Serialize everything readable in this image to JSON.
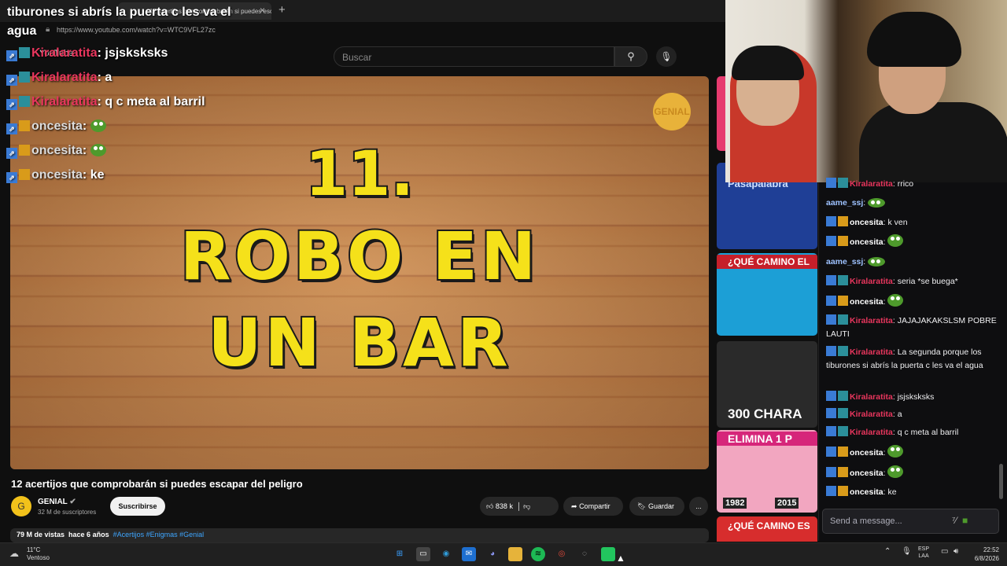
{
  "window_title": "tiburones si abrís la puerta c les va el agua",
  "browser": {
    "tab_title": "12 acertijos que comprobarán si puedes escapar del peligro",
    "url": "https://www.youtube.com/watch?v=WTC9VFL27zc"
  },
  "youtube": {
    "logo": "YouTube",
    "search_placeholder": "Buscar",
    "video_text": [
      "11.",
      "ROBO EN",
      "UN BAR"
    ],
    "badge": "GENIAL",
    "title": "12 acertijos que comprobarán si puedes escapar del peligro",
    "channel": {
      "name": "GENIAL",
      "subs": "32 M de suscriptores",
      "avatar": "G"
    },
    "subscribe_label": "Suscribirse",
    "likes": "838 k",
    "share_label": "Compartir",
    "save_label": "Guardar",
    "more_label": "...",
    "views": "79 M de vistas",
    "age": "hace 6 años",
    "tags": "#Acertijos #Enigmas #Genial"
  },
  "overlay_chat": [
    {
      "user": "Kiralaratita",
      "text": ": jsjsksksks"
    },
    {
      "user": "Kiralaratita",
      "text": ": a"
    },
    {
      "user": "Kiralaratita",
      "text": ": q c meta al barril"
    },
    {
      "user": "oncesita",
      "text": ": "
    },
    {
      "user": "oncesita",
      "text": ": "
    },
    {
      "user": "oncesita",
      "text": ": ke"
    }
  ],
  "recommendations": [
    {
      "label": ""
    },
    {
      "label": "Pasapalabra"
    },
    {
      "label": "¿QUÉ CAMINO EL"
    },
    {
      "label": "300 CHARA"
    },
    {
      "label": "ELIMINA 1 P"
    },
    {
      "label": "¿QUÉ CAMINO ES"
    }
  ],
  "rec_years": [
    "1982",
    "2015"
  ],
  "twitch_chat": {
    "messages": [
      {
        "user": "Kiralaratita",
        "text": "rrico"
      },
      {
        "user": "aame_ssj",
        "text": ""
      },
      {
        "user": "oncesita",
        "text": "k ven"
      },
      {
        "user": "oncesita",
        "text": ""
      },
      {
        "user": "aame_ssj",
        "text": ""
      },
      {
        "user": "Kiralaratita",
        "text": "seria *se buega*"
      },
      {
        "user": "oncesita",
        "text": ""
      },
      {
        "user": "Kiralaratita",
        "text": "JAJAJAKAKSLSM POBRE LAUTI"
      },
      {
        "user": "Kiralaratita",
        "text": "La segunda porque los tiburones si abrís la puerta c les va el agua"
      },
      {
        "user": "Kiralaratita",
        "text": "jsjsksksks"
      },
      {
        "user": "Kiralaratita",
        "text": "a"
      },
      {
        "user": "Kiralaratita",
        "text": "q c meta al barril"
      },
      {
        "user": "oncesita",
        "text": ""
      },
      {
        "user": "oncesita",
        "text": ""
      },
      {
        "user": "oncesita",
        "text": "ke"
      }
    ],
    "input_placeholder": "Send a message..."
  },
  "taskbar": {
    "temp": "11°C",
    "weather": "Ventoso",
    "lang": "ESP",
    "lang2": "LAA",
    "time": "22:52",
    "date": "6/8/2026"
  },
  "colors": {
    "accent_user": "#e8365d",
    "video_text": "#f5e11a",
    "link": "#3ea6ff"
  }
}
